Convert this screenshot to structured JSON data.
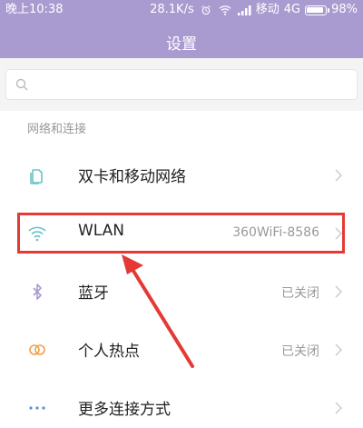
{
  "status_bar": {
    "time": "晚上10:38",
    "speed": "28.1K/s",
    "carrier": "移动",
    "network": "4G",
    "battery": "98%"
  },
  "header": {
    "title": "设置"
  },
  "search": {
    "placeholder": ""
  },
  "section": {
    "title": "网络和连接"
  },
  "items": [
    {
      "label": "双卡和移动网络",
      "value": "",
      "icon": "sim-card-icon"
    },
    {
      "label": "WLAN",
      "value": "360WiFi-8586",
      "icon": "wifi-icon"
    },
    {
      "label": "蓝牙",
      "value": "已关闭",
      "icon": "bluetooth-icon"
    },
    {
      "label": "个人热点",
      "value": "已关闭",
      "icon": "hotspot-icon"
    },
    {
      "label": "更多连接方式",
      "value": "",
      "icon": "more-dots-icon"
    }
  ],
  "colors": {
    "header_bg": "#a99bd0",
    "icon_accent": "#66c2c9",
    "highlight": "#e53935"
  }
}
